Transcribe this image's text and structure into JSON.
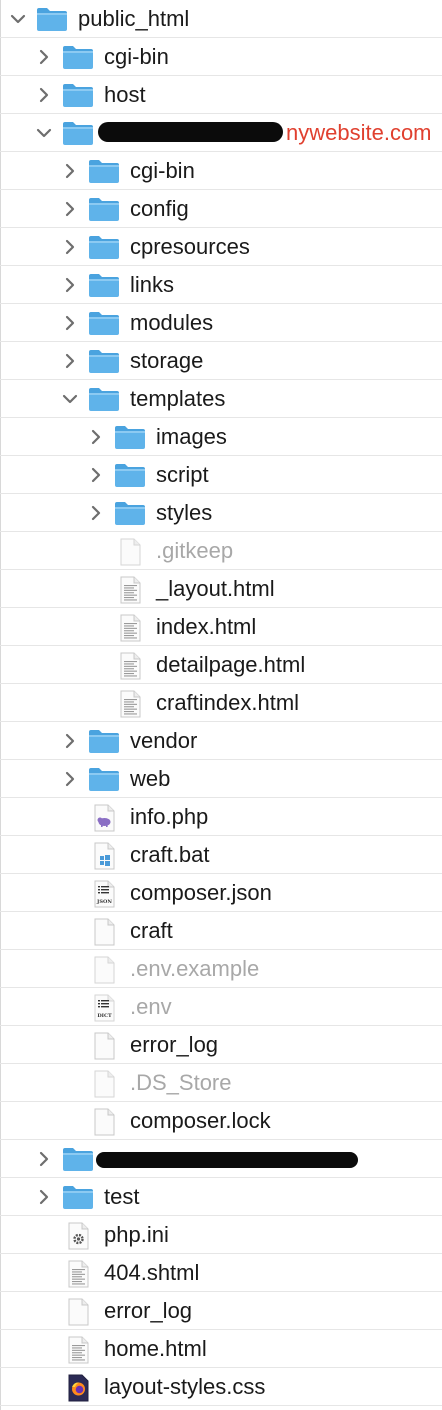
{
  "colors": {
    "folder_body": "#5fb3ea",
    "folder_tab": "#4aa3df",
    "chevron": "#6e6e6e",
    "redacted_suffix": "#e0402f"
  },
  "tree": [
    {
      "label": "public_html",
      "type": "folder",
      "expanded": true,
      "depth": 0
    },
    {
      "label": "cgi-bin",
      "type": "folder",
      "expanded": false,
      "depth": 1
    },
    {
      "label": "host",
      "type": "folder",
      "expanded": false,
      "depth": 1
    },
    {
      "label": "nywebsite.com",
      "type": "folder",
      "expanded": true,
      "depth": 1,
      "redacted": true
    },
    {
      "label": "cgi-bin",
      "type": "folder",
      "expanded": false,
      "depth": 2
    },
    {
      "label": "config",
      "type": "folder",
      "expanded": false,
      "depth": 2
    },
    {
      "label": "cpresources",
      "type": "folder",
      "expanded": false,
      "depth": 2
    },
    {
      "label": "links",
      "type": "folder",
      "expanded": false,
      "depth": 2
    },
    {
      "label": "modules",
      "type": "folder",
      "expanded": false,
      "depth": 2
    },
    {
      "label": "storage",
      "type": "folder",
      "expanded": false,
      "depth": 2
    },
    {
      "label": "templates",
      "type": "folder",
      "expanded": true,
      "depth": 2
    },
    {
      "label": "images",
      "type": "folder",
      "expanded": false,
      "depth": 3
    },
    {
      "label": "script",
      "type": "folder",
      "expanded": false,
      "depth": 3
    },
    {
      "label": "styles",
      "type": "folder",
      "expanded": false,
      "depth": 3
    },
    {
      "label": ".gitkeep",
      "type": "file",
      "icon": "blank-file-icon",
      "hidden": true,
      "depth": 3
    },
    {
      "label": "_layout.html",
      "type": "file",
      "icon": "html-file-icon",
      "depth": 3
    },
    {
      "label": "index.html",
      "type": "file",
      "icon": "html-file-icon",
      "depth": 3
    },
    {
      "label": "detailpage.html",
      "type": "file",
      "icon": "html-file-icon",
      "depth": 3
    },
    {
      "label": "craftindex.html",
      "type": "file",
      "icon": "html-file-icon",
      "depth": 3
    },
    {
      "label": "vendor",
      "type": "folder",
      "expanded": false,
      "depth": 2
    },
    {
      "label": "web",
      "type": "folder",
      "expanded": false,
      "depth": 2
    },
    {
      "label": "info.php",
      "type": "file",
      "icon": "php-file-icon",
      "depth": 2
    },
    {
      "label": "craft.bat",
      "type": "file",
      "icon": "windows-file-icon",
      "depth": 2
    },
    {
      "label": "composer.json",
      "type": "file",
      "icon": "json-file-icon",
      "depth": 2,
      "badge": "JSON"
    },
    {
      "label": "craft",
      "type": "file",
      "icon": "blank-file-icon",
      "depth": 2
    },
    {
      "label": ".env.example",
      "type": "file",
      "icon": "blank-file-icon",
      "hidden": true,
      "depth": 2
    },
    {
      "label": ".env",
      "type": "file",
      "icon": "dict-file-icon",
      "hidden": true,
      "depth": 2,
      "badge": "DICT"
    },
    {
      "label": "error_log",
      "type": "file",
      "icon": "blank-file-icon",
      "depth": 2
    },
    {
      "label": ".DS_Store",
      "type": "file",
      "icon": "blank-file-icon",
      "hidden": true,
      "depth": 2
    },
    {
      "label": "composer.lock",
      "type": "file",
      "icon": "blank-file-icon",
      "depth": 2
    },
    {
      "label": "",
      "type": "folder",
      "expanded": false,
      "depth": 1,
      "redacted": true
    },
    {
      "label": "test",
      "type": "folder",
      "expanded": false,
      "depth": 1
    },
    {
      "label": "php.ini",
      "type": "file",
      "icon": "settings-file-icon",
      "depth": 1
    },
    {
      "label": "404.shtml",
      "type": "file",
      "icon": "html-file-icon",
      "depth": 1
    },
    {
      "label": "error_log",
      "type": "file",
      "icon": "blank-file-icon",
      "depth": 1
    },
    {
      "label": "home.html",
      "type": "file",
      "icon": "html-file-icon",
      "depth": 1
    },
    {
      "label": "layout-styles.css",
      "type": "file",
      "icon": "firefox-file-icon",
      "depth": 1
    }
  ]
}
